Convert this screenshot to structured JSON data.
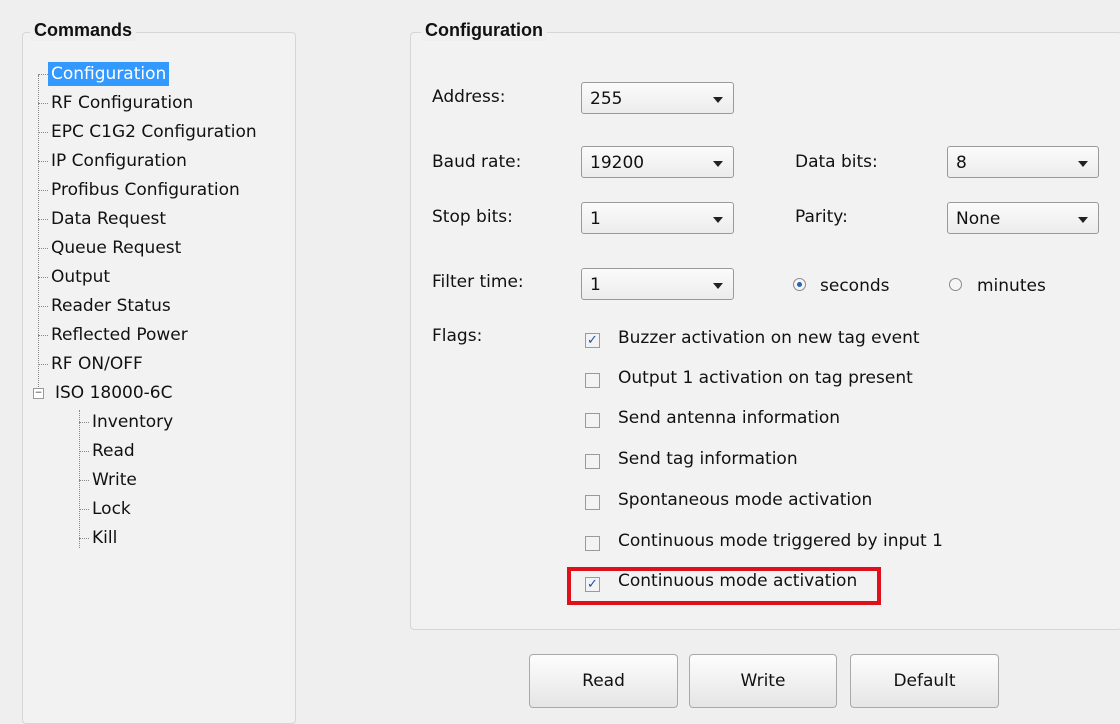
{
  "commands": {
    "title": "Commands",
    "items": [
      "Configuration",
      "RF Configuration",
      "EPC C1G2 Configuration",
      "IP Configuration",
      "Profibus Configuration",
      "Data Request",
      "Queue Request",
      "Output",
      "Reader Status",
      "Reflected Power",
      "RF ON/OFF",
      "ISO 18000-6C"
    ],
    "iso_children": [
      "Inventory",
      "Read",
      "Write",
      "Lock",
      "Kill"
    ],
    "expander_symbol": "−",
    "selected": "Configuration"
  },
  "config": {
    "title": "Configuration",
    "address_label": "Address:",
    "address_value": "255",
    "baud_label": "Baud rate:",
    "baud_value": "19200",
    "databits_label": "Data bits:",
    "databits_value": "8",
    "stopbits_label": "Stop bits:",
    "stopbits_value": "1",
    "parity_label": "Parity:",
    "parity_value": "None",
    "filter_label": "Filter time:",
    "filter_value": "1",
    "unit_seconds": "seconds",
    "unit_minutes": "minutes",
    "unit_selected": "seconds",
    "flags_label": "Flags:",
    "flags": [
      {
        "label": "Buzzer activation on new tag event",
        "checked": true
      },
      {
        "label": "Output 1 activation on tag present",
        "checked": false
      },
      {
        "label": "Send antenna information",
        "checked": false
      },
      {
        "label": "Send tag information",
        "checked": false
      },
      {
        "label": "Spontaneous mode activation",
        "checked": false
      },
      {
        "label": "Continuous mode triggered by input 1",
        "checked": false
      },
      {
        "label": "Continuous mode activation",
        "checked": true
      }
    ],
    "check_mark": "✓",
    "highlight_color": "#e0101b"
  },
  "buttons": {
    "read": "Read",
    "write": "Write",
    "default": "Default"
  }
}
